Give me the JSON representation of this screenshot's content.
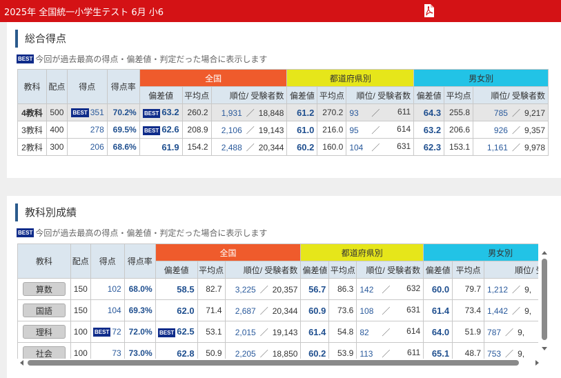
{
  "header": {
    "title": "2025年 全国統一小学生テスト 6月 小6",
    "pdf_icon": "pdf-icon"
  },
  "best_label": "BEST",
  "section1": {
    "title": "総合得点",
    "note": "今回が過去最高の得点・偏差値・判定だった場合に表示します",
    "headers": {
      "kyoka": "教科",
      "haiten": "配点",
      "tokuten": "得点",
      "tokutenritsu": "得点率",
      "zenkoku": "全国",
      "todofuken": "都道府県別",
      "danjo": "男女別",
      "hensachi": "偏差値",
      "heikin": "平均点",
      "juni": "順位/ 受験者数"
    },
    "rows": [
      {
        "name": "4教科",
        "haiten": "500",
        "best_score": true,
        "tokuten": "351",
        "ritsu": "70.2%",
        "best_dev": true,
        "z_dev": "63.2",
        "z_avg": "260.2",
        "z_rank": "1,931",
        "z_total": "18,848",
        "t_dev": "61.2",
        "t_avg": "270.2",
        "t_rank": "93",
        "t_total": "611",
        "d_dev": "64.3",
        "d_avg": "255.8",
        "d_rank": "785",
        "d_total": "9,217"
      },
      {
        "name": "3教科",
        "haiten": "400",
        "best_score": false,
        "tokuten": "278",
        "ritsu": "69.5%",
        "best_dev": true,
        "z_dev": "62.6",
        "z_avg": "208.9",
        "z_rank": "2,106",
        "z_total": "19,143",
        "t_dev": "61.0",
        "t_avg": "216.0",
        "t_rank": "95",
        "t_total": "614",
        "d_dev": "63.2",
        "d_avg": "206.6",
        "d_rank": "926",
        "d_total": "9,357"
      },
      {
        "name": "2教科",
        "haiten": "300",
        "best_score": false,
        "tokuten": "206",
        "ritsu": "68.6%",
        "best_dev": false,
        "z_dev": "61.9",
        "z_avg": "154.2",
        "z_rank": "2,488",
        "z_total": "20,344",
        "t_dev": "60.2",
        "t_avg": "160.0",
        "t_rank": "104",
        "t_total": "631",
        "d_dev": "62.3",
        "d_avg": "153.1",
        "d_rank": "1,161",
        "d_total": "9,978"
      }
    ]
  },
  "section2": {
    "title": "教科別成績",
    "note": "今回が過去最高の得点・偏差値・判定だった場合に表示します",
    "rows": [
      {
        "name": "算数",
        "haiten": "150",
        "best_score": false,
        "tokuten": "102",
        "ritsu": "68.0%",
        "best_dev": false,
        "z_dev": "58.5",
        "z_avg": "82.7",
        "z_rank": "3,225",
        "z_total": "20,357",
        "t_dev": "56.7",
        "t_avg": "86.3",
        "t_rank": "142",
        "t_total": "632",
        "d_dev": "60.0",
        "d_avg": "79.7",
        "d_rank": "1,212",
        "d_total": "9,"
      },
      {
        "name": "国語",
        "haiten": "150",
        "best_score": false,
        "tokuten": "104",
        "ritsu": "69.3%",
        "best_dev": false,
        "z_dev": "62.0",
        "z_avg": "71.4",
        "z_rank": "2,687",
        "z_total": "20,344",
        "t_dev": "60.9",
        "t_avg": "73.6",
        "t_rank": "108",
        "t_total": "631",
        "d_dev": "61.4",
        "d_avg": "73.4",
        "d_rank": "1,442",
        "d_total": "9,"
      },
      {
        "name": "理科",
        "haiten": "100",
        "best_score": true,
        "tokuten": "72",
        "ritsu": "72.0%",
        "best_dev": true,
        "z_dev": "62.5",
        "z_avg": "53.1",
        "z_rank": "2,015",
        "z_total": "19,143",
        "t_dev": "61.4",
        "t_avg": "54.8",
        "t_rank": "82",
        "t_total": "614",
        "d_dev": "64.0",
        "d_avg": "51.9",
        "d_rank": "787",
        "d_total": "9,"
      },
      {
        "name": "社会",
        "haiten": "100",
        "best_score": false,
        "tokuten": "73",
        "ritsu": "73.0%",
        "best_dev": false,
        "z_dev": "62.8",
        "z_avg": "50.9",
        "z_rank": "2,205",
        "z_total": "18,850",
        "t_dev": "60.2",
        "t_avg": "53.9",
        "t_rank": "113",
        "t_total": "611",
        "d_dev": "65.1",
        "d_avg": "48.7",
        "d_rank": "753",
        "d_total": "9,"
      }
    ]
  }
}
